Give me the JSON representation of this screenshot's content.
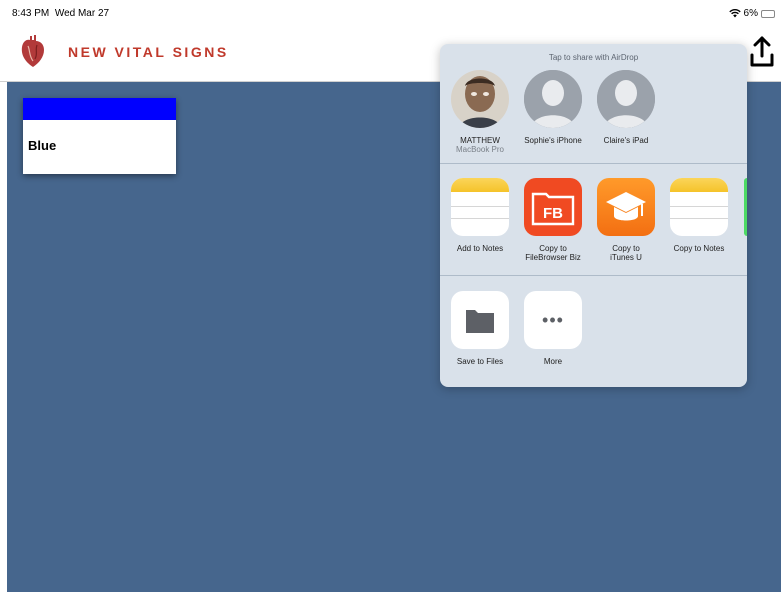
{
  "status_bar": {
    "time": "8:43 PM",
    "date": "Wed Mar 27",
    "battery": "6%"
  },
  "app": {
    "title": "NEW VITAL SIGNS",
    "logo_icon": "heart-icon",
    "share_icon": "share-icon"
  },
  "card": {
    "label": "Blue",
    "swatch_color": "#0000ff"
  },
  "share_sheet": {
    "airdrop_hint": "Tap to share with AirDrop",
    "airdrop_targets": [
      {
        "name": "MATTHEW",
        "sub": "MacBook Pro",
        "icon": "person-photo-avatar"
      },
      {
        "name": "Sophie's iPhone",
        "sub": "",
        "icon": "person-silhouette-icon"
      },
      {
        "name": "Claire's iPad",
        "sub": "",
        "icon": "person-silhouette-icon"
      }
    ],
    "apps": [
      {
        "line1": "Add to Notes",
        "line2": "",
        "icon": "notes-icon"
      },
      {
        "line1": "Copy to",
        "line2": "FileBrowser Biz",
        "icon": "filebrowser-icon",
        "glyph": "FB"
      },
      {
        "line1": "Copy to",
        "line2": "iTunes U",
        "icon": "itunes-u-icon"
      },
      {
        "line1": "Copy to Notes",
        "line2": "",
        "icon": "notes-icon"
      }
    ],
    "actions": [
      {
        "label": "Save to Files",
        "icon": "folder-icon"
      },
      {
        "label": "More",
        "icon": "more-icon",
        "glyph": "•••"
      }
    ]
  },
  "colors": {
    "background": "#46668d",
    "title": "#c0392b",
    "sheet": "#d9e1ea"
  }
}
